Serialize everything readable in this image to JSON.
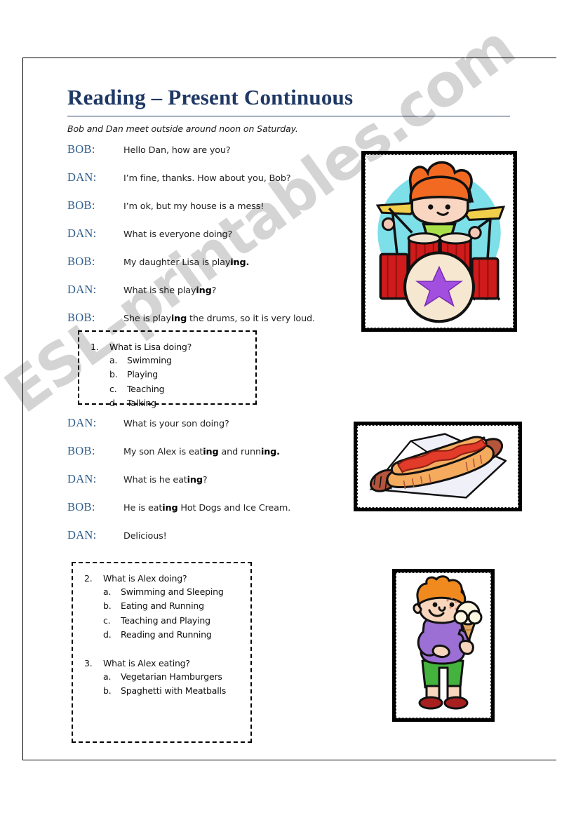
{
  "document": {
    "title": "Reading – Present Continuous",
    "intro": "Bob and Dan meet outside around noon on Saturday.",
    "watermark": "ESL-printables.com",
    "accent_color": "#1F3864",
    "speaker_color": "#2E5C8A",
    "rule_color": "#26406c"
  },
  "dialogue_one": [
    {
      "speaker": "BOB:",
      "pre": "Hello Dan, how are you?",
      "bold": "",
      "post": ""
    },
    {
      "speaker": "DAN:",
      "pre": "I’m fine, thanks. How about you, Bob?",
      "bold": "",
      "post": ""
    },
    {
      "speaker": "BOB:",
      "pre": "I’m ok, but my house is a mess!",
      "bold": "",
      "post": ""
    },
    {
      "speaker": "DAN:",
      "pre": "What is everyone doing?",
      "bold": "",
      "post": ""
    },
    {
      "speaker": "BOB:",
      "pre": "My daughter Lisa is play",
      "bold": "ing.",
      "post": ""
    },
    {
      "speaker": "DAN:",
      "pre": "What is she play",
      "bold": "ing",
      "post": "?"
    },
    {
      "speaker": "BOB:",
      "pre": "She is play",
      "bold": "ing",
      "post": " the drums, so it is very loud."
    }
  ],
  "dialogue_two": [
    {
      "speaker": "DAN:",
      "pre": "What is your son doing?",
      "bold": "",
      "post": ""
    },
    {
      "speaker": "BOB:",
      "pre": "My son Alex is eat",
      "bold": "ing",
      "post": " and runn",
      "bold2": "ing.",
      "post2": ""
    },
    {
      "speaker": "DAN:",
      "pre": "What is he eat",
      "bold": "ing",
      "post": "?"
    },
    {
      "speaker": "BOB:",
      "pre": "He is eat",
      "bold": "ing",
      "post": " Hot Dogs and Ice Cream."
    },
    {
      "speaker": "DAN:",
      "pre": "Delicious!",
      "bold": "",
      "post": ""
    }
  ],
  "question_box_1": {
    "questions": [
      {
        "number": "1.",
        "prompt": "What is Lisa doing?",
        "options": [
          {
            "letter": "a.",
            "text": "Swimming"
          },
          {
            "letter": "b.",
            "text": "Playing"
          },
          {
            "letter": "c.",
            "text": "Teaching"
          },
          {
            "letter": "d.",
            "text": "Talking"
          }
        ]
      }
    ]
  },
  "question_box_2": {
    "questions": [
      {
        "number": "2.",
        "prompt": "What is Alex doing?",
        "options": [
          {
            "letter": "a.",
            "text": "Swimming and Sleeping"
          },
          {
            "letter": "b.",
            "text": "Eating and Running"
          },
          {
            "letter": "c.",
            "text": "Teaching and Playing"
          },
          {
            "letter": "d.",
            "text": "Reading and Running"
          }
        ]
      },
      {
        "number": "3.",
        "prompt": "What is Alex eating?",
        "options": [
          {
            "letter": "a.",
            "text": "Vegetarian Hamburgers"
          },
          {
            "letter": "b.",
            "text": "Spaghetti with Meatballs"
          }
        ]
      }
    ]
  },
  "images": [
    {
      "name": "drummer-girl-clipart",
      "description": "Cartoon girl with orange hair playing a red drum kit on a cyan circle background; purple star on the bass drum."
    },
    {
      "name": "hot-dog-clipart",
      "description": "Hot dog in a bun with ketchup, resting on a white napkin."
    },
    {
      "name": "boy-with-ice-cream-clipart",
      "description": "Cartoon boy with orange hair, purple shirt, green shorts and red shoes holding a vanilla ice cream cone."
    }
  ]
}
